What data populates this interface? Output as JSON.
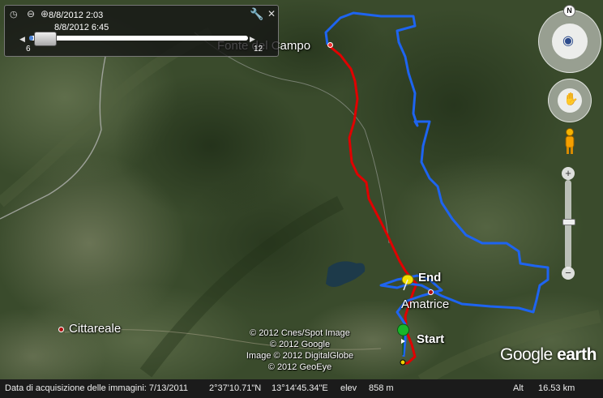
{
  "time_slider": {
    "start_time": "8/8/2012   2:03",
    "end_time": "8/8/2012   6:45",
    "min_label": "6",
    "max_label": "12",
    "progress": 0.02
  },
  "places": {
    "fonte_del_campo": "Fonte del Campo",
    "cittareale": "Cittareale",
    "amatrice": "Amatrice"
  },
  "track_labels": {
    "end": "End",
    "start": "Start"
  },
  "colors": {
    "track_red": "#e00000",
    "track_blue": "#1e64f0",
    "place_dot_red": "#b01010"
  },
  "credits": [
    "© 2012 Cnes/Spot Image",
    "© 2012 Google",
    "Image © 2012 DigitalGlobe",
    "© 2012 GeoEye"
  ],
  "logo": {
    "google": "Google",
    "earth": "earth"
  },
  "status": {
    "imagery_date": "Data di acquisizione delle immagini: 7/13/2011",
    "lat": "2°37'10.71\"N",
    "lon": "13°14'45.34\"E",
    "elev_label": "elev",
    "elev": "858 m",
    "alt_label": "Alt",
    "alt": "16.53 km"
  },
  "controls": {
    "compass_north": "N",
    "zoom_in": "+",
    "zoom_out": "−",
    "close": "✕"
  },
  "icons": [
    "clock-icon",
    "zoom-out-icon",
    "zoom-in-icon",
    "wrench-icon",
    "close-icon",
    "compass-icon",
    "look-icon",
    "move-hand-icon",
    "pegman-icon",
    "start-pin-icon",
    "end-pushpin-icon"
  ]
}
